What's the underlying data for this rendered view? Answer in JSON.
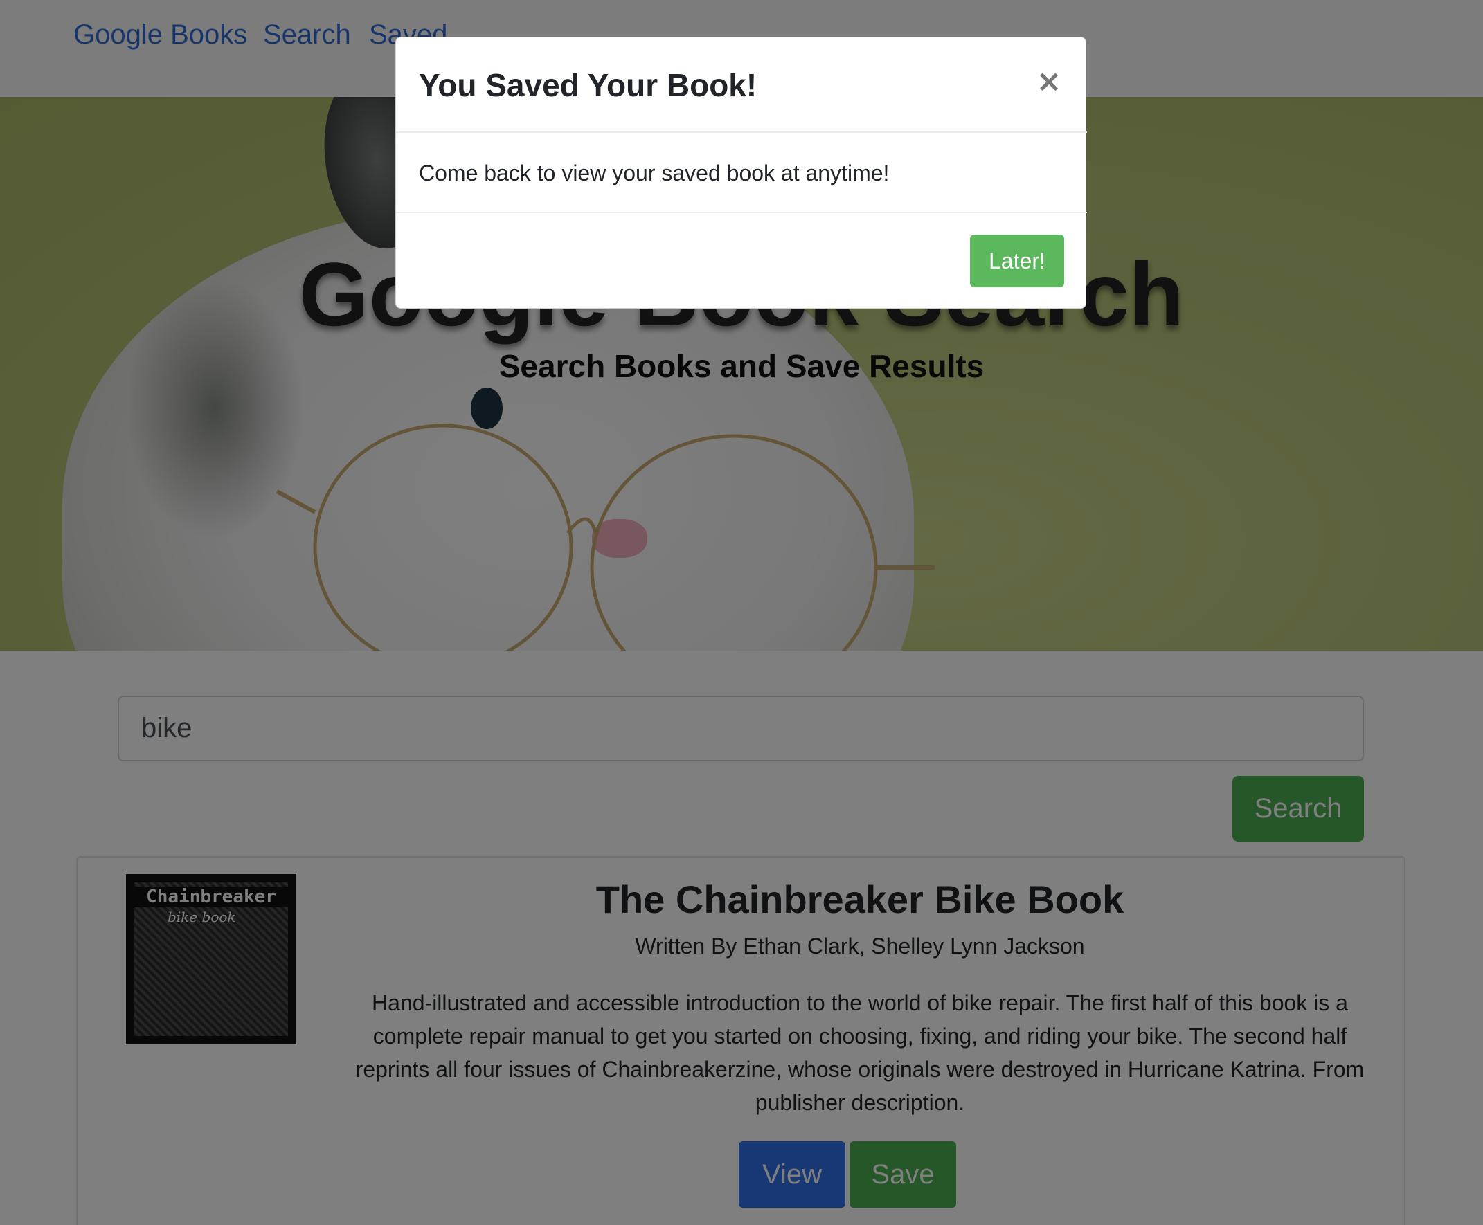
{
  "navbar": {
    "brand": "Google Books",
    "links": [
      "Search",
      "Saved"
    ]
  },
  "hero": {
    "title": "Google Book Search",
    "subtitle": "Search Books and Save Results"
  },
  "search": {
    "value": "bike",
    "button_label": "Search"
  },
  "results": [
    {
      "cover_title": "Chainbreaker",
      "cover_subtitle": "bike book",
      "title": "The Chainbreaker Bike Book",
      "authors": "Written By Ethan Clark, Shelley Lynn Jackson",
      "description": "Hand-illustrated and accessible introduction to the world of bike repair. The first half of this book is a complete repair manual to get you started on choosing, fixing, and riding your bike. The second half reprints all four issues of Chainbreakerzine, whose originals were destroyed in Hurricane Katrina. From publisher description.",
      "view_label": "View",
      "save_label": "Save"
    }
  ],
  "modal": {
    "title": "You Saved Your Book!",
    "close_glyph": "×",
    "body": "Come back to view your saved book at anytime!",
    "later_label": "Later!"
  },
  "colors": {
    "link": "#2e6bd3",
    "primary": "#2f6fea",
    "success": "#4caf50",
    "backdrop": "rgba(0,0,0,0.5)"
  }
}
